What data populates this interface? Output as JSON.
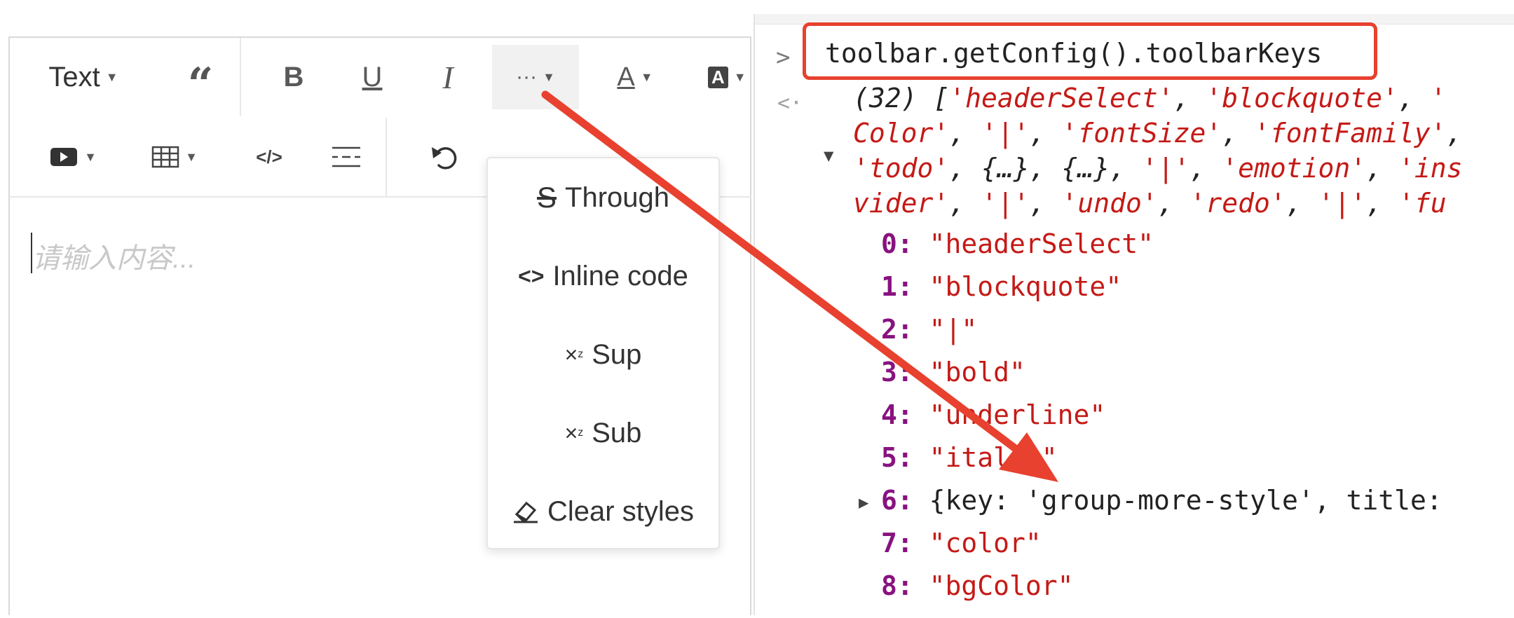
{
  "editor": {
    "toolbar_row1": {
      "header_select_label": "Text",
      "blockquote_icon": "quote-icon",
      "bold_label": "B",
      "underline_label": "U",
      "italic_label": "I",
      "more_label": "···",
      "font_color_label": "A",
      "bg_color_label": "A"
    },
    "toolbar_row2": {
      "video_icon": "video-icon",
      "table_icon": "table-icon",
      "code_block_label": "</>",
      "divider_icon": "divider-icon",
      "undo_icon": "undo-icon"
    },
    "placeholder": "请输入内容..."
  },
  "dropdown": {
    "items": [
      {
        "icon": "strikethrough-icon",
        "label": "Through"
      },
      {
        "icon": "inline-code-icon",
        "label": "Inline code"
      },
      {
        "icon": "superscript-icon",
        "label": "Sup"
      },
      {
        "icon": "subscript-icon",
        "label": "Sub"
      },
      {
        "icon": "eraser-icon",
        "label": "Clear styles"
      }
    ]
  },
  "console": {
    "command": "toolbar.getConfig().toolbarKeys",
    "summary_lines": [
      {
        "plain_start": "(32) [",
        "parts": [
          "'headerSelect'",
          ", ",
          "'blockquote'",
          ", ",
          "'"
        ]
      },
      {
        "parts": [
          "Color'",
          ", ",
          "'|'",
          ", ",
          "'fontSize'",
          ", ",
          "'fontFamily'",
          ","
        ]
      },
      {
        "parts": [
          "'todo'",
          ", ",
          "{…}",
          ", ",
          "{…}",
          ", ",
          "'|'",
          ", ",
          "'emotion'",
          ", ",
          "'ins"
        ]
      },
      {
        "parts": [
          "vider'",
          ", ",
          "'|'",
          ", ",
          "'undo'",
          ", ",
          "'redo'",
          ", ",
          "'|'",
          ", ",
          "'fu"
        ]
      }
    ],
    "entries": [
      {
        "key": "0",
        "value": "\"headerSelect\""
      },
      {
        "key": "1",
        "value": "\"blockquote\""
      },
      {
        "key": "2",
        "value": "\"|\""
      },
      {
        "key": "3",
        "value": "\"bold\""
      },
      {
        "key": "4",
        "value": "\"underline\""
      },
      {
        "key": "5",
        "value": "\"italic\""
      },
      {
        "key": "6",
        "value": "{key: 'group-more-style', title:"
      },
      {
        "key": "7",
        "value": "\"color\""
      },
      {
        "key": "8",
        "value": "\"bgColor\""
      }
    ]
  },
  "colors": {
    "highlight_red": "#e8412f",
    "string_red": "#c41a16",
    "key_purple": "#881280"
  }
}
